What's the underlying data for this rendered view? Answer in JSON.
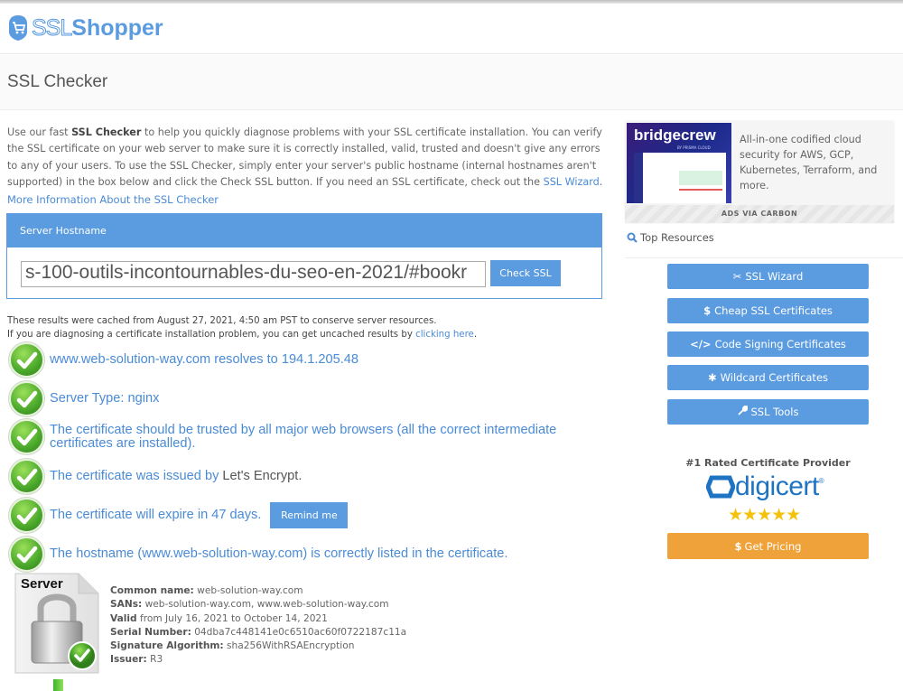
{
  "header": {
    "logo_ssl": "SSL",
    "logo_shopper": "Shopper"
  },
  "page": {
    "title": "SSL Checker"
  },
  "intro": {
    "text_before": "Use our fast ",
    "bold": "SSL Checker",
    "text_after": " to help you quickly diagnose problems with your SSL certificate installation. You can verify the SSL certificate on your web server to make sure it is correctly installed, valid, trusted and doesn't give any errors to any of your users. To use the SSL Checker, simply enter your server's public hostname (internal hostnames aren't supported) in the box below and click the Check SSL button. If you need an SSL certificate, check out the ",
    "wizard_link": "SSL Wizard",
    "end": ".",
    "more_info_link": "More Information About the SSL Checker"
  },
  "hostname_form": {
    "label": "Server Hostname",
    "input_value": "s-100-outils-incontournables-du-seo-en-2021/#bookr",
    "button": "Check SSL"
  },
  "cache_notice": {
    "line1": "These results were cached from August 27, 2021, 4:50 am PST to conserve server resources.",
    "line2_before": "If you are diagnosing a certificate installation problem, you can get uncached results by ",
    "line2_link": "clicking here",
    "line2_end": "."
  },
  "results": [
    {
      "text": "www.web-solution-way.com resolves to 194.1.205.48"
    },
    {
      "text": "Server Type: nginx"
    },
    {
      "text": "The certificate should be trusted by all major web browsers (all the correct intermediate certificates are installed)."
    },
    {
      "text": "The certificate was issued by ",
      "issuer": "Let's Encrypt."
    },
    {
      "text": "The certificate will expire in 47 days.",
      "button": "Remind me"
    },
    {
      "text": "The hostname (www.web-solution-way.com) is correctly listed in the certificate."
    }
  ],
  "certificate": {
    "icon_label": "Server",
    "common_name_label": "Common name:",
    "common_name": " web-solution-way.com",
    "sans_label": "SANs:",
    "sans": " web-solution-way.com, www.web-solution-way.com",
    "valid_label": "Valid",
    "valid": " from July 16, 2021 to October 14, 2021",
    "serial_label": "Serial Number:",
    "serial": " 04dba7c448141e0c6510ac60f0722187c11a",
    "sig_label": "Signature Algorithm:",
    "sig": " sha256WithRSAEncryption",
    "issuer_label": "Issuer:",
    "issuer": " R3"
  },
  "ad": {
    "brand": "bridgecrew",
    "brand_sub": "BY PRISMA CLOUD",
    "text": "All-in-one codified cloud security for AWS, GCP, Kubernetes, Terraform, and more.",
    "via": "ADS VIA CARBON"
  },
  "sidebar": {
    "top_resources": "Top Resources",
    "buttons": [
      {
        "icon": "✂",
        "label": "SSL Wizard"
      },
      {
        "icon": "$",
        "label": "Cheap SSL Certificates"
      },
      {
        "icon": "</>",
        "label": "Code Signing Certificates"
      },
      {
        "icon": "✱",
        "label": "Wildcard Certificates"
      },
      {
        "icon": "🔧",
        "label": "SSL Tools"
      }
    ],
    "rated": "#1 Rated Certificate Provider",
    "provider": "digicert",
    "rating": 5,
    "stars": "★★★★★",
    "pricing_icon": "$",
    "pricing": "Get Pricing"
  },
  "colors": {
    "accent": "#5b9be0",
    "link": "#4a8bd6",
    "pricing": "#f0a23a",
    "success": "#4aa82a"
  }
}
